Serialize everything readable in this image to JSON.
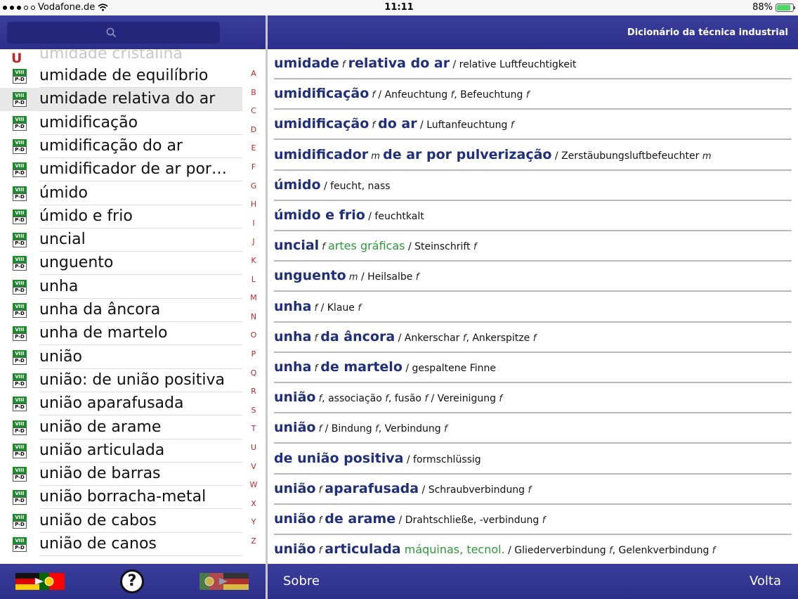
{
  "status_bar": {
    "carrier": "Vodafone.de",
    "time": "11:11",
    "battery": "88%",
    "battery_level": 0.88
  },
  "left": {
    "section_letter": "U",
    "ghost_word": "umidade cristalina",
    "badge_top": "VIII",
    "badge_bottom": "P-D",
    "selected_index": 1,
    "words": [
      "umidade de equilíbrio",
      "umidade relativa do ar",
      "umidificação",
      "umidificação do ar",
      "umidificador de ar por…",
      "úmido",
      "úmido e frio",
      "uncial",
      "unguento",
      "unha",
      "unha da âncora",
      "unha de martelo",
      "união",
      "união: de união positiva",
      "união aparafusada",
      "união de arame",
      "união articulada",
      "união de barras",
      "união borracha-metal",
      "união de cabos",
      "união de canos"
    ],
    "alphabet": [
      "A",
      "B",
      "C",
      "D",
      "E",
      "F",
      "G",
      "H",
      "I",
      "J",
      "K",
      "L",
      "M",
      "N",
      "O",
      "P",
      "Q",
      "R",
      "S",
      "T",
      "U",
      "V",
      "W",
      "X",
      "Y",
      "Z"
    ],
    "help_label": "?"
  },
  "right": {
    "title": "Dicionário da técnica industrial",
    "entries": [
      [
        [
          "hw",
          "umidade"
        ],
        [
          "gen",
          " f "
        ],
        [
          "hw",
          "relativa do ar"
        ],
        [
          "tr",
          " / relative Luftfeuchtigkeit"
        ]
      ],
      [
        [
          "hw",
          "umidificação"
        ],
        [
          "gen",
          " f"
        ],
        [
          "tr",
          " / Anfeuchtung "
        ],
        [
          "gen",
          "f"
        ],
        [
          "tr",
          ", Befeuchtung "
        ],
        [
          "gen",
          "f"
        ]
      ],
      [
        [
          "hw",
          "umidificação"
        ],
        [
          "gen",
          " f "
        ],
        [
          "hw",
          "do ar"
        ],
        [
          "tr",
          " / Luftanfeuchtung "
        ],
        [
          "gen",
          "f"
        ]
      ],
      [
        [
          "hw",
          "umidificador"
        ],
        [
          "gen",
          " m "
        ],
        [
          "hw",
          "de ar por pulverização"
        ],
        [
          "tr",
          " / Zerstäubungsluftbefeuchter "
        ],
        [
          "gen",
          "m"
        ]
      ],
      [
        [
          "hw",
          "úmido"
        ],
        [
          "tr",
          " / feucht, nass"
        ]
      ],
      [
        [
          "hw",
          "úmido e frio"
        ],
        [
          "tr",
          " / feuchtkalt"
        ]
      ],
      [
        [
          "hw",
          "uncial"
        ],
        [
          "gen",
          " f "
        ],
        [
          "dom",
          "artes gráficas"
        ],
        [
          "tr",
          " / Steinschrift "
        ],
        [
          "gen",
          "f"
        ]
      ],
      [
        [
          "hw",
          "unguento"
        ],
        [
          "gen",
          " m"
        ],
        [
          "tr",
          " / Heilsalbe "
        ],
        [
          "gen",
          "f"
        ]
      ],
      [
        [
          "hw",
          "unha"
        ],
        [
          "gen",
          " f"
        ],
        [
          "tr",
          " / Klaue "
        ],
        [
          "gen",
          "f"
        ]
      ],
      [
        [
          "hw",
          "unha"
        ],
        [
          "gen",
          " f "
        ],
        [
          "hw",
          "da âncora"
        ],
        [
          "tr",
          " / Ankerschar "
        ],
        [
          "gen",
          "f"
        ],
        [
          "tr",
          ", Ankerspitze "
        ],
        [
          "gen",
          "f"
        ]
      ],
      [
        [
          "hw",
          "unha"
        ],
        [
          "gen",
          " f "
        ],
        [
          "hw",
          "de martelo"
        ],
        [
          "tr",
          " / gespaltene Finne"
        ]
      ],
      [
        [
          "hw",
          "união"
        ],
        [
          "gen",
          " f"
        ],
        [
          "tr",
          ", associação "
        ],
        [
          "gen",
          "f"
        ],
        [
          "tr",
          ", fusão "
        ],
        [
          "gen",
          "f"
        ],
        [
          "tr",
          " / Vereinigung "
        ],
        [
          "gen",
          "f"
        ]
      ],
      [
        [
          "hw",
          "união"
        ],
        [
          "gen",
          " f"
        ],
        [
          "tr",
          " / Bindung "
        ],
        [
          "gen",
          "f"
        ],
        [
          "tr",
          ", Verbindung "
        ],
        [
          "gen",
          "f"
        ]
      ],
      [
        [
          "hw",
          "de união positiva"
        ],
        [
          "tr",
          " / formschlüssig"
        ]
      ],
      [
        [
          "hw",
          "união"
        ],
        [
          "gen",
          " f "
        ],
        [
          "hw",
          "aparafusada"
        ],
        [
          "tr",
          " / Schraubverbindung "
        ],
        [
          "gen",
          "f"
        ]
      ],
      [
        [
          "hw",
          "união"
        ],
        [
          "gen",
          " f "
        ],
        [
          "hw",
          "de arame"
        ],
        [
          "tr",
          " / Drahtschließe, -verbindung "
        ],
        [
          "gen",
          "f"
        ]
      ],
      [
        [
          "hw",
          "união"
        ],
        [
          "gen",
          " f "
        ],
        [
          "hw",
          "articulada"
        ],
        [
          "dom",
          " máquinas, tecnol."
        ],
        [
          "tr",
          " / Gliederverbindung "
        ],
        [
          "gen",
          "f"
        ],
        [
          "tr",
          ", Gelenkverbindung "
        ],
        [
          "gen",
          "f"
        ]
      ]
    ],
    "footer": {
      "about_label": "Sobre",
      "back_label": "Volta"
    }
  },
  "colors": {
    "header_blue": "#2c2f8a",
    "headword_blue": "#1f2f7a",
    "domain_green": "#2e9a3a",
    "index_red": "#c0262d"
  }
}
